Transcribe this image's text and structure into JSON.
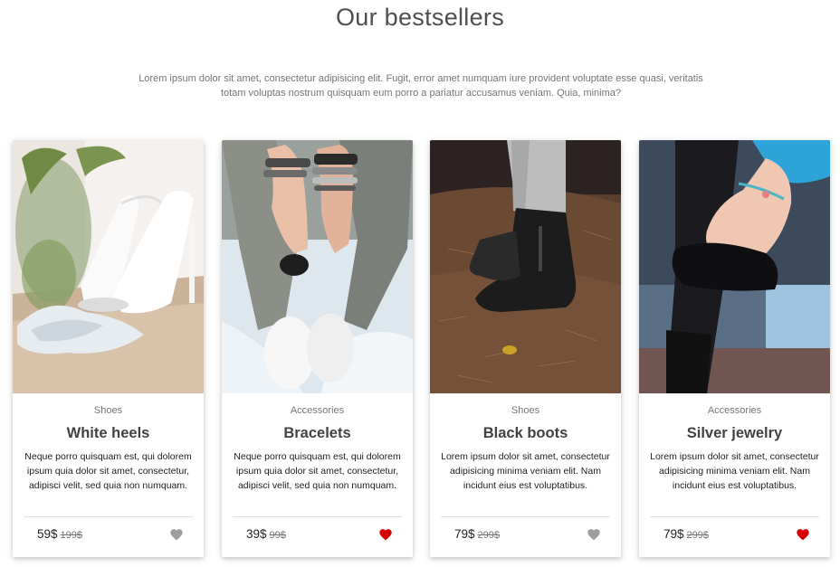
{
  "section": {
    "title": "Our bestsellers",
    "lead": "Lorem ipsum dolor sit amet, consectetur adipisicing elit. Fugit, error amet numquam iure provident voluptate esse quasi, veritatis totam voluptas nostrum quisquam eum porro a pariatur accusamus veniam. Quia, minima?"
  },
  "colors": {
    "heart_active": "#d50000",
    "heart_inactive": "#9e9e9e"
  },
  "products": [
    {
      "category": "Shoes",
      "title": "White heels",
      "description": "Neque porro quisquam est, qui dolorem ipsum quia dolor sit amet, consectetur, adipisci velit, sed quia non numquam.",
      "price": "59$",
      "old_price": "199$",
      "favorite": false,
      "fav_icon": "heart-icon"
    },
    {
      "category": "Accessories",
      "title": "Bracelets",
      "description": "Neque porro quisquam est, qui dolorem ipsum quia dolor sit amet, consectetur, adipisci velit, sed quia non numquam.",
      "price": "39$",
      "old_price": "99$",
      "favorite": true,
      "fav_icon": "heart-icon"
    },
    {
      "category": "Shoes",
      "title": "Black boots",
      "description": "Lorem ipsum dolor sit amet, consectetur adipisicing minima veniam elit. Nam incidunt eius est voluptatibus.",
      "price": "79$",
      "old_price": "299$",
      "favorite": false,
      "fav_icon": "heart-icon"
    },
    {
      "category": "Accessories",
      "title": "Silver jewelry",
      "description": "Lorem ipsum dolor sit amet, consectetur adipisicing minima veniam elit. Nam incidunt eius est voluptatibus.",
      "price": "79$",
      "old_price": "299$",
      "favorite": true,
      "fav_icon": "heart-icon"
    }
  ]
}
